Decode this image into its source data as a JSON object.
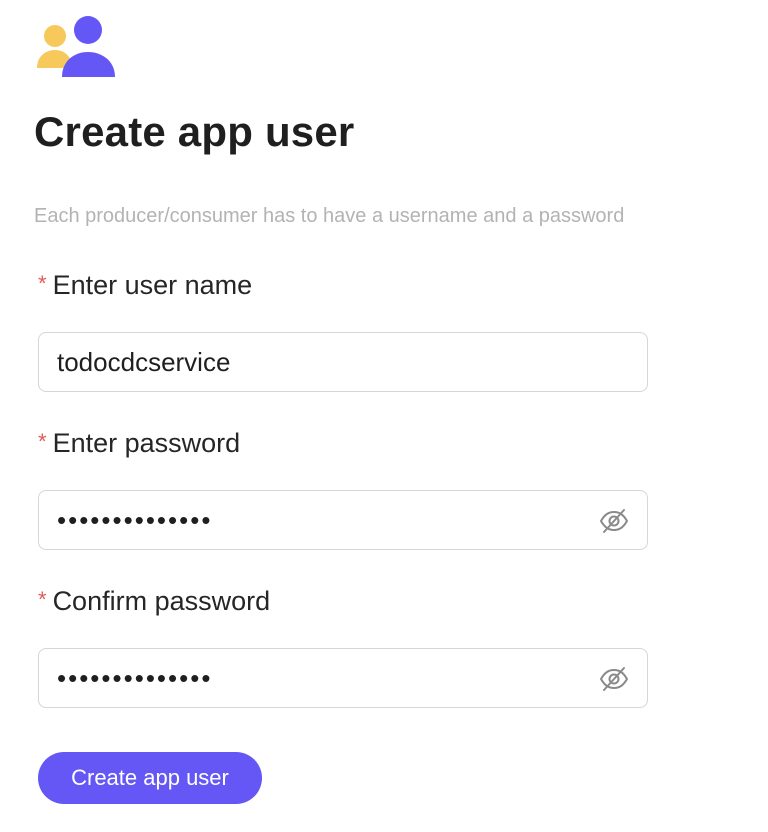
{
  "header": {
    "icon": "users-icon",
    "title": "Create app user",
    "subtitle": "Each producer/consumer has to have a username and a password"
  },
  "form": {
    "required_marker": "*",
    "username": {
      "label": "Enter user name",
      "value": "todocdcservice"
    },
    "password": {
      "label": "Enter password",
      "value": "••••••••••••••",
      "toggle_icon": "eye-off-icon"
    },
    "confirm_password": {
      "label": "Confirm password",
      "value": "••••••••••••••",
      "toggle_icon": "eye-off-icon"
    },
    "submit_label": "Create app user"
  },
  "colors": {
    "accent": "#6557f5",
    "secondary_person": "#f7c85a",
    "required": "#e05a5a",
    "subtitle": "#b3b3b3",
    "border": "#d6d6d6"
  }
}
